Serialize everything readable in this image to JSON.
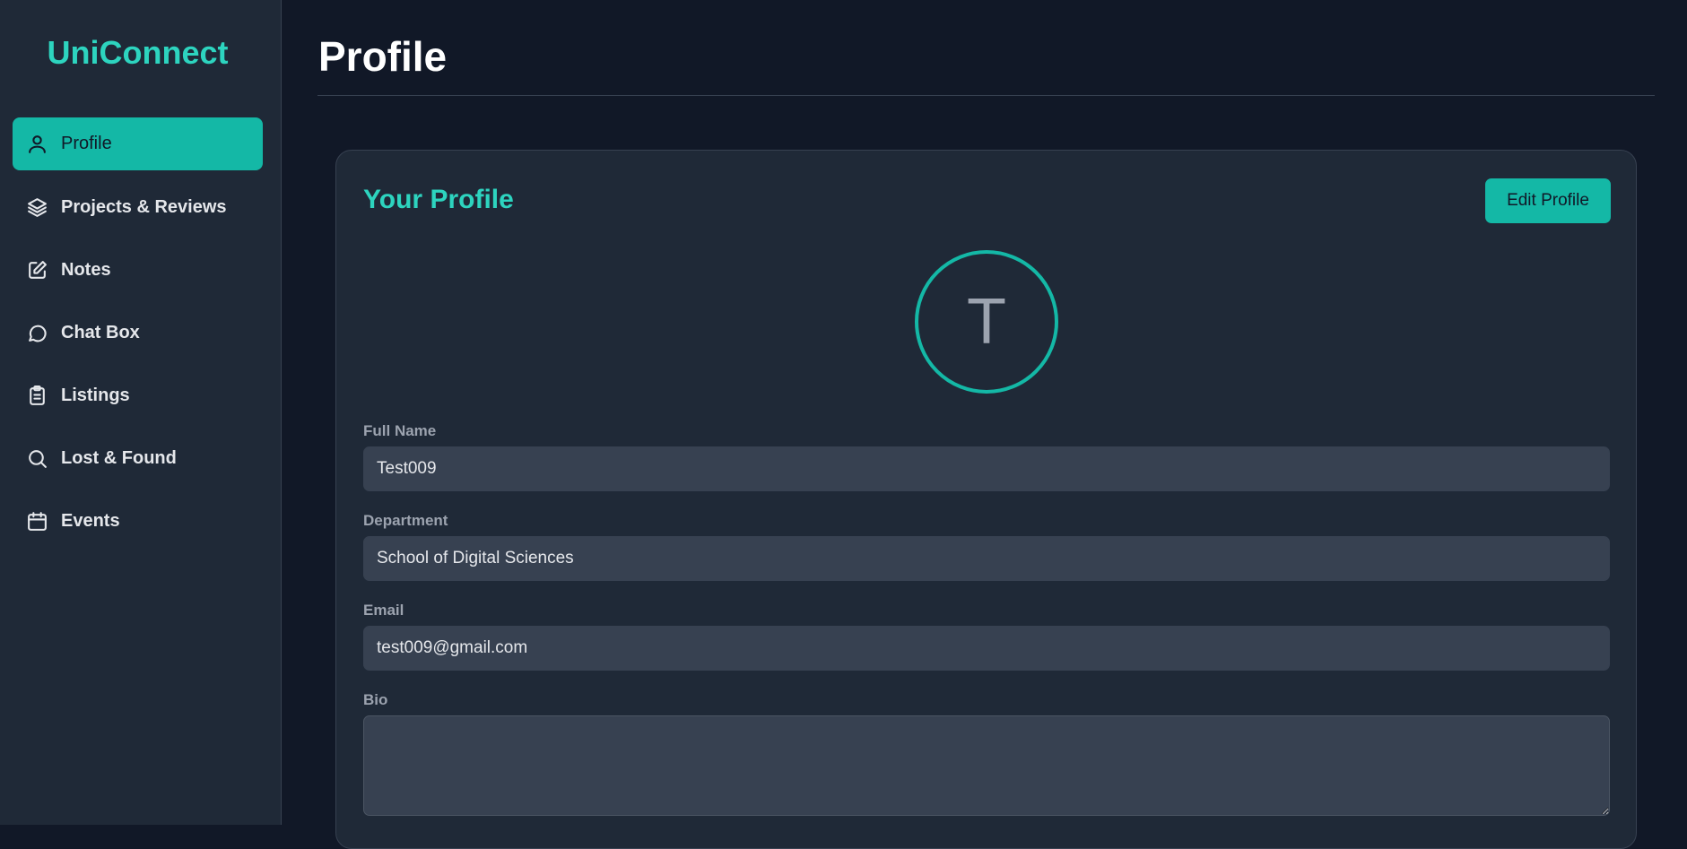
{
  "app": {
    "brand": "UniConnect"
  },
  "sidebar": {
    "items": [
      {
        "label": "Profile",
        "icon": "user-icon",
        "active": true
      },
      {
        "label": "Projects & Reviews",
        "icon": "layers-icon",
        "active": false
      },
      {
        "label": "Notes",
        "icon": "edit-square-icon",
        "active": false
      },
      {
        "label": "Chat Box",
        "icon": "chat-bubble-icon",
        "active": false
      },
      {
        "label": "Listings",
        "icon": "clipboard-list-icon",
        "active": false
      },
      {
        "label": "Lost & Found",
        "icon": "search-icon",
        "active": false
      },
      {
        "label": "Events",
        "icon": "calendar-icon",
        "active": false
      }
    ]
  },
  "main": {
    "page_title": "Profile",
    "card": {
      "title": "Your Profile",
      "edit_button_label": "Edit Profile",
      "avatar_initial": "T",
      "fields": {
        "full_name": {
          "label": "Full Name",
          "value": "Test009"
        },
        "department": {
          "label": "Department",
          "value": "School of Digital Sciences"
        },
        "email": {
          "label": "Email",
          "value": "test009@gmail.com"
        },
        "bio": {
          "label": "Bio",
          "value": ""
        }
      }
    }
  },
  "colors": {
    "accent": "#14b8a6",
    "accent_text": "#2dd4bf",
    "background": "#111827",
    "surface": "#1f2937",
    "input": "#374151"
  }
}
